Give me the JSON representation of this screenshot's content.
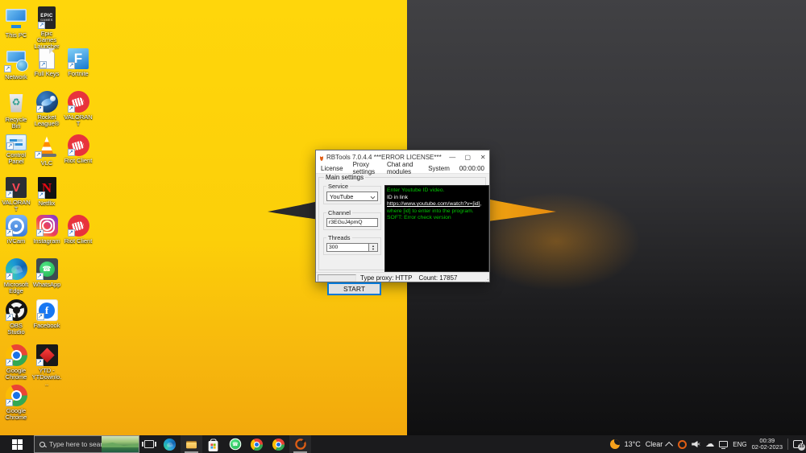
{
  "theme": {
    "yellow": "#FFD60B",
    "amber": "#F2A80C",
    "dark_top": "#414144",
    "dark_bottom": "#0f0f10",
    "wing_dark": "#29292b",
    "wing_yellow": "#F7C117",
    "wing_orange": "#E88B0E",
    "accent_blue": "#0078D7",
    "console_green": "#00C400",
    "riot_red": "#E8333C",
    "taskbar_bg": "#1b1b1d"
  },
  "desktop": {
    "icons": [
      {
        "label": "This PC",
        "kind": "this-pc",
        "col": 0,
        "row": 0,
        "shortcut": false
      },
      {
        "label": "Epic Games Launcher",
        "kind": "epic",
        "col": 1,
        "row": 0,
        "shortcut": true
      },
      {
        "label": "Network",
        "kind": "network",
        "col": 0,
        "row": 1,
        "shortcut": true
      },
      {
        "label": "Full Keys",
        "kind": "fullkeys",
        "col": 1,
        "row": 1,
        "shortcut": true
      },
      {
        "label": "Fortnite",
        "kind": "fortnite",
        "col": 2,
        "row": 1,
        "shortcut": true
      },
      {
        "label": "Recycle Bin",
        "kind": "recycle",
        "col": 0,
        "row": 2,
        "shortcut": false
      },
      {
        "label": "Rocket League®",
        "kind": "rocket",
        "col": 1,
        "row": 2,
        "shortcut": true
      },
      {
        "label": "VALORANT",
        "kind": "riot-fist",
        "col": 2,
        "row": 2,
        "shortcut": true
      },
      {
        "label": "Control Panel",
        "kind": "control-panel",
        "col": 0,
        "row": 3,
        "shortcut": true
      },
      {
        "label": "VLC",
        "kind": "vlc",
        "col": 1,
        "row": 3,
        "shortcut": true
      },
      {
        "label": "Riot Client",
        "kind": "riot-fist",
        "col": 2,
        "row": 3,
        "shortcut": true
      },
      {
        "label": "VALORANT",
        "kind": "valorant",
        "col": 0,
        "row": 4,
        "shortcut": true
      },
      {
        "label": "Netflix",
        "kind": "netflix",
        "col": 1,
        "row": 4,
        "shortcut": true
      },
      {
        "label": "iVCam",
        "kind": "ivcam",
        "col": 0,
        "row": 5,
        "shortcut": true
      },
      {
        "label": "Instagram",
        "kind": "instagram",
        "col": 1,
        "row": 5,
        "shortcut": true
      },
      {
        "label": "Riot Client",
        "kind": "riot-fist",
        "col": 2,
        "row": 5,
        "shortcut": true
      },
      {
        "label": "Microsoft Edge",
        "kind": "edge",
        "col": 0,
        "row": 6,
        "shortcut": true
      },
      {
        "label": "WhatsApp",
        "kind": "whatsapp-sq",
        "col": 1,
        "row": 6,
        "shortcut": true
      },
      {
        "label": "OBS Studio",
        "kind": "obs",
        "col": 0,
        "row": 7,
        "shortcut": true
      },
      {
        "label": "Facebook",
        "kind": "facebook",
        "col": 1,
        "row": 7,
        "shortcut": true
      },
      {
        "label": "Google Chrome",
        "kind": "chrome",
        "col": 0,
        "row": 8,
        "shortcut": true
      },
      {
        "label": "YTD - YTDownlo...",
        "kind": "ytd",
        "col": 1,
        "row": 8,
        "shortcut": true
      },
      {
        "label": "Google Chrome",
        "kind": "chrome",
        "col": 0,
        "row": 9,
        "shortcut": true
      }
    ]
  },
  "window": {
    "title": "RBTools 7.0.4.4 ***ERROR LICENSE***",
    "controls": {
      "minimize": "—",
      "maximize": "▢",
      "close": "✕"
    },
    "menu": [
      "License",
      "Proxy settings",
      "Chat and modules",
      "System",
      "00:00:00"
    ],
    "group_label": "Main settings",
    "service": {
      "label": "Service",
      "value": "YouTube"
    },
    "channel": {
      "label": "Channel",
      "value": "r3EGuJ4pmQ"
    },
    "threads": {
      "label": "Threads",
      "value": "300"
    },
    "start_label": "START",
    "console": {
      "line1": "Enter Youtube ID video.",
      "line2_prefix": "ID in link ",
      "line2_link": "https://www.youtube.com/watch?v=[id]",
      "line2_suffix": ",",
      "line3": "where [id] to enter into the program.",
      "line4": "SOFT: Error check version"
    },
    "status": {
      "proxy": "Type proxy: HTTP",
      "count": "Count: 17857"
    }
  },
  "taskbar": {
    "search_placeholder": "Type here to search",
    "apps": [
      {
        "name": "edge",
        "kind": "edge",
        "active": false
      },
      {
        "name": "file-explorer",
        "kind": "folder",
        "active": true
      },
      {
        "name": "microsoft-store",
        "kind": "store",
        "active": false
      },
      {
        "name": "whatsapp",
        "kind": "whatsapp-round",
        "active": false
      },
      {
        "name": "chrome",
        "kind": "chrome",
        "active": false
      },
      {
        "name": "chrome-2",
        "kind": "chrome",
        "active": false
      },
      {
        "name": "rbtools",
        "kind": "ring",
        "active": true
      }
    ],
    "tray": {
      "weather_temp": "13°C",
      "weather_condition": "Clear",
      "language": "ENG",
      "time": "00:39",
      "date": "02-02-2023",
      "notification_count": "15"
    }
  }
}
